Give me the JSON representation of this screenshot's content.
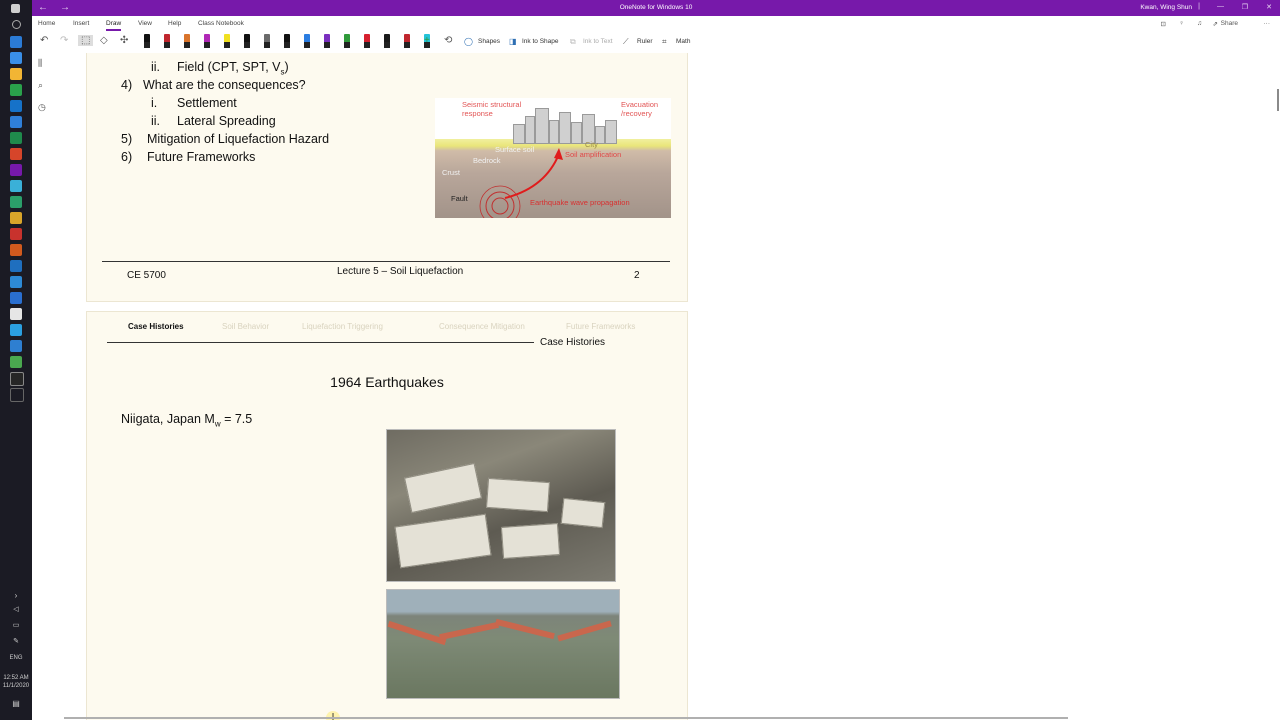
{
  "window": {
    "title": "OneNote for Windows 10",
    "user": "Kwan, Wing Shun",
    "accent": "#7719aa"
  },
  "taskbar": {
    "language": "ENG",
    "time": "12:52 AM",
    "date": "11/1/2020"
  },
  "menu": {
    "items": [
      "Home",
      "Insert",
      "Draw",
      "View",
      "Help",
      "Class Notebook"
    ],
    "active": "Draw",
    "share": "Share"
  },
  "ribbon": {
    "shapes": "Shapes",
    "ink_to_shape": "Ink to Shape",
    "ink_to_text": "Ink to Text",
    "ruler": "Ruler",
    "math": "Math",
    "pen_colors": [
      "#111111",
      "#c0262d",
      "#d9742b",
      "#b028b6",
      "#f0e020",
      "#111111",
      "#6a6a6a",
      "#111111",
      "#2a7de1",
      "#7a2fbf",
      "#2f9a3a",
      "#d6202e",
      "#1a1a1a",
      "#c0262d",
      "#25c3d8"
    ]
  },
  "slide1": {
    "outline": [
      {
        "num": "ii.",
        "text": "Field (CPT, SPT, V",
        "sub": "s",
        "suffix": ")"
      },
      {
        "num": "4)",
        "text": "What are the consequences?"
      },
      {
        "num": "i.",
        "text": "Settlement"
      },
      {
        "num": "ii.",
        "text": "Lateral Spreading"
      },
      {
        "num": "5)",
        "text": "Mitigation of Liquefaction Hazard"
      },
      {
        "num": "6)",
        "text": "Future Frameworks"
      }
    ],
    "diagram": {
      "seismic": "Seismic structural response",
      "evacuation": "Evacuation /recovery",
      "surface_soil": "Surface soil",
      "city": "City",
      "bedrock": "Bedrock",
      "soil_amp": "Soil amplification",
      "crust": "Crust",
      "fault": "Fault",
      "wave": "Earthquake wave propagation"
    },
    "footer": {
      "course": "CE 5700",
      "lecture": "Lecture 5 – Soil Liquefaction",
      "page": "2"
    }
  },
  "slide2": {
    "tabs": [
      "Case Histories",
      "Soil Behavior",
      "Liquefaction Triggering",
      "Consequence Mitigation",
      "Future Frameworks"
    ],
    "section": "Case Histories",
    "heading": "1964 Earthquakes",
    "subtitle_pre": "Niigata, Japan M",
    "subtitle_sub": "w",
    "subtitle_post": " = 7.5"
  }
}
